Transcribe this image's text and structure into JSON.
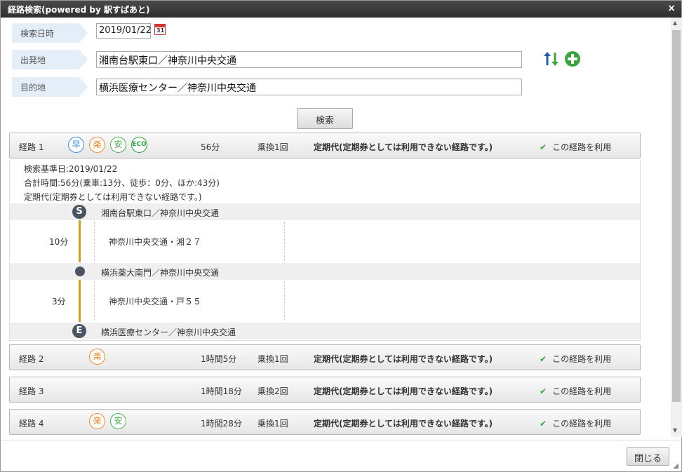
{
  "window": {
    "title": "経路検索(powered by 駅すぱあと)",
    "close_icon": "×"
  },
  "form": {
    "date_label": "検索日時",
    "date_value": "2019/01/22",
    "calendar_day": "31",
    "from_label": "出発地",
    "from_value": "湘南台駅東口／神奈川中央交通",
    "to_label": "目的地",
    "to_value": "横浜医療センター／神奈川中央交通",
    "search_label": "検索"
  },
  "icons": {
    "swap": "swap-icon",
    "add": "add-icon",
    "check": "✔"
  },
  "colors": {
    "fast": "#3a8ee6",
    "easy": "#f08a2a",
    "safe": "#4cb050",
    "eco": "#2e9e3e",
    "line": "#d4a017",
    "check": "#3aa53a"
  },
  "routes": [
    {
      "name": "経路 1",
      "badges": [
        "早",
        "楽",
        "安",
        "ECO"
      ],
      "time": "56分",
      "transfers": "乗換1回",
      "fare": "定期代(定期券としては利用できない経路です。)",
      "use_label": "この経路を利用"
    },
    {
      "name": "経路 2",
      "badges": [
        "楽"
      ],
      "time": "1時間5分",
      "transfers": "乗換1回",
      "fare": "定期代(定期券としては利用できない経路です。)",
      "use_label": "この経路を利用"
    },
    {
      "name": "経路 3",
      "badges": [],
      "time": "1時間18分",
      "transfers": "乗換2回",
      "fare": "定期代(定期券としては利用できない経路です。)",
      "use_label": "この経路を利用"
    },
    {
      "name": "経路 4",
      "badges": [
        "楽",
        "安"
      ],
      "time": "1時間28分",
      "transfers": "乗換1回",
      "fare": "定期代(定期券としては利用できない経路です。)",
      "use_label": "この経路を利用"
    }
  ],
  "detail": {
    "base_date": "検索基準日:2019/01/22",
    "total_time": "合計時間:56分(乗車:13分、徒歩：0分、ほか:43分)",
    "fare_note": "定期代(定期券としては利用できない経路です。)",
    "stops": [
      {
        "marker": "S",
        "name": "湘南台駅東口／神奈川中央交通"
      },
      {
        "marker": "",
        "name": "横浜薬大南門／神奈川中央交通"
      },
      {
        "marker": "E",
        "name": "横浜医療センター／神奈川中央交通"
      }
    ],
    "segments": [
      {
        "time": "10分",
        "line": "神奈川中央交通・湘２７"
      },
      {
        "time": "3分",
        "line": "神奈川中央交通・戸５５"
      }
    ]
  },
  "footer": {
    "close_label": "閉じる",
    "resize_icon": "◢"
  },
  "scrollbar": {
    "up": "▲",
    "down": "▼"
  }
}
